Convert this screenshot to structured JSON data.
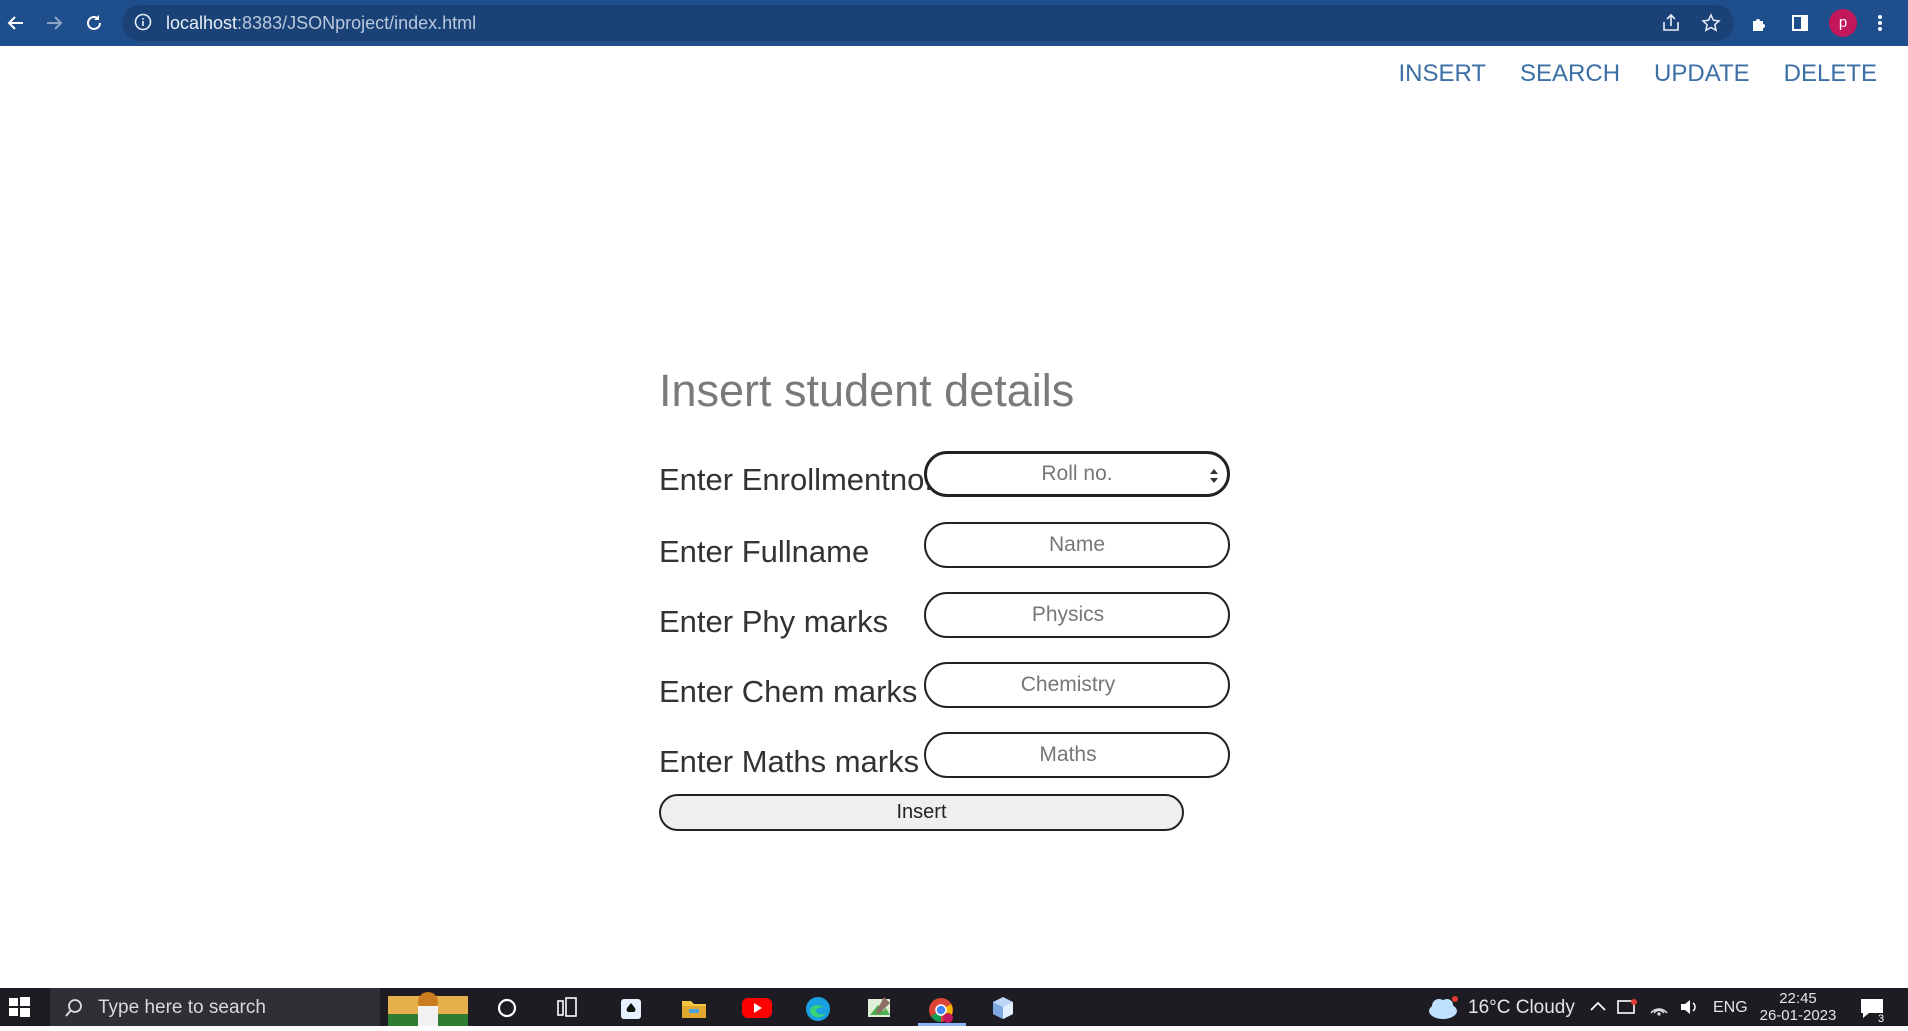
{
  "browser": {
    "url_host": "localhost",
    "url_rest": ":8383/JSONproject/index.html",
    "profile_initial": "p",
    "icons": [
      "back-icon",
      "forward-icon",
      "reload-icon",
      "info-icon",
      "share-icon",
      "star-icon",
      "extensions-icon",
      "sidepanel-icon",
      "menu-icon"
    ]
  },
  "nav": {
    "items": [
      "INSERT",
      "SEARCH",
      "UPDATE",
      "DELETE"
    ],
    "color": "#3b6fa6"
  },
  "form": {
    "title": "Insert student details",
    "rows": [
      {
        "label": "Enter Enrollmentno.",
        "placeholder": "Roll no.",
        "type": "number"
      },
      {
        "label": "Enter Fullname",
        "placeholder": "Name",
        "type": "text"
      },
      {
        "label": "Enter Phy marks",
        "placeholder": "Physics",
        "type": "text"
      },
      {
        "label": "Enter Chem marks",
        "placeholder": "Chemistry",
        "type": "text"
      },
      {
        "label": "Enter Maths marks",
        "placeholder": "Maths",
        "type": "text"
      }
    ],
    "submit_label": "Insert"
  },
  "taskbar": {
    "search_placeholder": "Type here to search",
    "weather": "16°C  Cloudy",
    "language": "ENG",
    "time": "22:45",
    "date": "26-01-2023",
    "notification_count": "3",
    "icons": [
      "windows-start-icon",
      "search-icon",
      "cortana-icon",
      "task-view-icon",
      "solitaire-icon",
      "file-explorer-icon",
      "youtube-icon",
      "edge-icon",
      "paint-icon",
      "chrome-icon",
      "cube-icon",
      "cloud-icon",
      "chevron-up-icon",
      "meet-icon",
      "network-icon",
      "volume-icon",
      "notifications-icon"
    ]
  }
}
